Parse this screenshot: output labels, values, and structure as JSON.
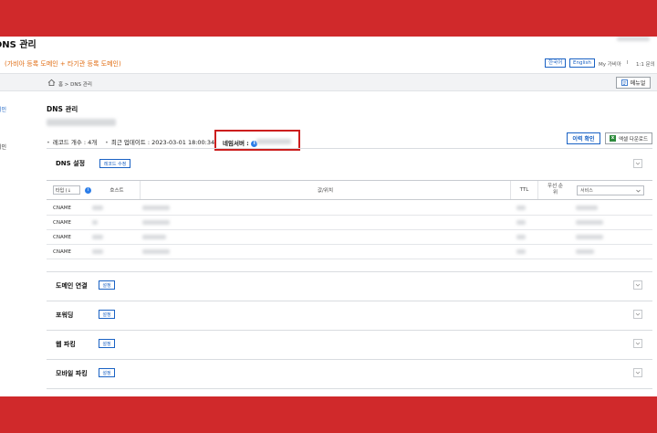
{
  "header": {
    "title": "DNS 관리",
    "subtitle": "(가비아 등록 도메인 + 타기관 등록 도메인)",
    "lang_ko": "한국어",
    "lang_en": "English",
    "my_gabia": "My 가비아",
    "separator": "l",
    "inquiry": "1:1 문의"
  },
  "breadcrumb": {
    "text": "홈 > DNS 관리",
    "menu_label": "메뉴얼"
  },
  "sidebar": {
    "items": [
      {
        "label": "메인"
      },
      {
        "label": "메인"
      }
    ]
  },
  "main": {
    "title": "DNS 관리",
    "record_count": "레코드 개수 : 4개",
    "last_update": "최근 업데이트 : 2023-03-01 18:00:34",
    "nameserver_label": "네임서버 :",
    "history_btn": "이력 확인",
    "excel_btn": "엑셀 다운로드"
  },
  "dns_settings": {
    "title": "DNS 설정",
    "edit_btn": "레코드 수정",
    "columns": {
      "type": "타입 (↓",
      "host": "호스트",
      "value": "값/위치",
      "ttl": "TTL",
      "priority": "우선 순위",
      "service": "서비스"
    },
    "rows": [
      {
        "type": "CNAME"
      },
      {
        "type": "CNAME"
      },
      {
        "type": "CNAME"
      },
      {
        "type": "CNAME"
      }
    ]
  },
  "sections": [
    {
      "title": "도메인 연결",
      "btn": "설정"
    },
    {
      "title": "포워딩",
      "btn": "설정"
    },
    {
      "title": "웹 파킹",
      "btn": "설정"
    },
    {
      "title": "모바일 파킹",
      "btn": "설정"
    }
  ],
  "colors": {
    "brand_red": "#d0292b",
    "accent_blue": "#1a62c4",
    "highlight_red": "#cc1e1e",
    "orange": "#e06b10"
  },
  "icons": [
    "home-icon",
    "manual-icon",
    "info-icon",
    "excel-icon",
    "chevron-down-icon",
    "collapse-icon"
  ]
}
